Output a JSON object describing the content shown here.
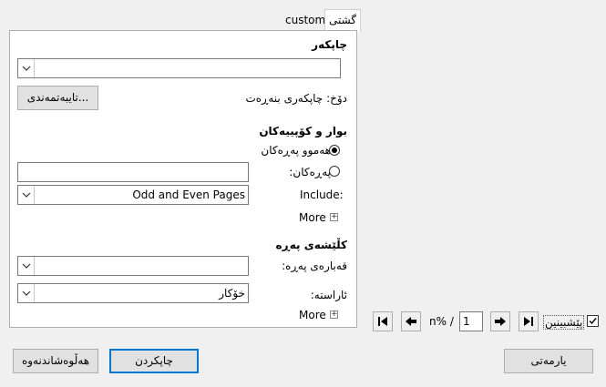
{
  "tabs": {
    "general": "گشتی",
    "custom": "custom"
  },
  "printer": {
    "heading": "چاپکەر",
    "value": "",
    "status": "دۆخ:  چاپکەری بنەڕەت",
    "properties_button": "تایبەتمەندی..."
  },
  "range": {
    "heading": "بوار و کۆپییەکان",
    "all_pages": "هەموو پەڕەکان",
    "pages": "پەڕەکان:",
    "pages_value": "",
    "include_label": "Include:",
    "include_value": "Odd and Even Pages",
    "more": "More"
  },
  "layout": {
    "heading": "کڵێشەی پەڕە",
    "paper_size_label": "قەبارەی پەڕە:",
    "paper_size_value": "",
    "orientation_label": "ئاراستە:",
    "orientation_value": "خۆکار",
    "more": "More"
  },
  "preview": {
    "page_number": "1",
    "total_pages": "n% /",
    "preview_label": "پێشبینین",
    "preview_checked": true
  },
  "buttons": {
    "help": "یارمەتی",
    "print": "چاپکردن",
    "cancel": "هەڵوەشاندنەوە"
  }
}
